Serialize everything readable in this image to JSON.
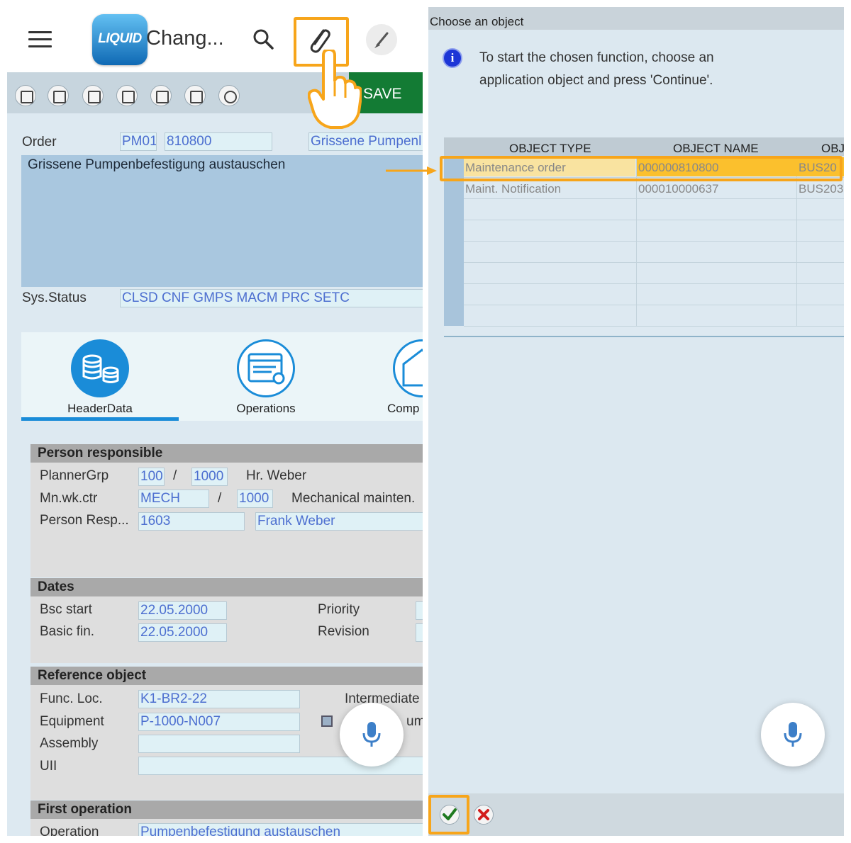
{
  "left": {
    "app_title": "Chang...",
    "logo_text": "LIQUID",
    "save_label": "SAVE",
    "order": {
      "label": "Order",
      "type": "PM01",
      "number": "810800",
      "short_text": "Grissene Pumpenl",
      "long_text": "Grissene Pumpenbefestigung austauschen"
    },
    "sys_status": {
      "label": "Sys.Status",
      "value": "CLSD CNF  GMPS MACM PRC  SETC"
    },
    "tabs": [
      {
        "label": "HeaderData"
      },
      {
        "label": "Operations"
      },
      {
        "label": "Comp"
      }
    ],
    "person_section": {
      "title": "Person responsible",
      "planner_label": "PlannerGrp",
      "planner_value": "100",
      "planner_sep": "/",
      "planner_plant": "1000",
      "planner_name": "Hr. Weber",
      "workctr_label": "Mn.wk.ctr",
      "workctr_value": "MECH",
      "workctr_sep": "/",
      "workctr_plant": "1000",
      "workctr_desc": "Mechanical mainten.",
      "resp_label": "Person Resp...",
      "resp_value": "1603",
      "resp_name": "Frank Weber"
    },
    "dates_section": {
      "title": "Dates",
      "start_label": "Bsc start",
      "start_value": "22.05.2000",
      "finish_label": "Basic fin.",
      "finish_value": "22.05.2000",
      "priority_label": "Priority",
      "revision_label": "Revision"
    },
    "ref_section": {
      "title": "Reference object",
      "funcloc_label": "Func. Loc.",
      "funcloc_value": "K1-BR2-22",
      "intermediate_label": "Intermediate",
      "equipment_label": "Equipment",
      "equipment_value": "P-1000-N007",
      "sum_label": "um",
      "assembly_label": "Assembly",
      "uii_label": "UII"
    },
    "first_op_section": {
      "title": "First operation",
      "op_label": "Operation",
      "op_value": "Pumpenbefestigung austauschen"
    }
  },
  "right": {
    "dialog_title": "Choose an object",
    "info_line1": "To start the chosen function, choose an",
    "info_line2": "application object and press 'Continue'.",
    "columns": [
      "OBJECT TYPE",
      "OBJECT NAME",
      "OBJ"
    ],
    "rows": [
      {
        "type": "Maintenance order",
        "name": "000000810800",
        "obj": "BUS20"
      },
      {
        "type": "Maint. Notification",
        "name": "000010000637",
        "obj": "BUS203"
      }
    ]
  },
  "colors": {
    "accent_orange": "#f7a51a",
    "save_green": "#137b34",
    "tab_blue": "#1a8cd8",
    "selected_row": "#fbc02d"
  }
}
